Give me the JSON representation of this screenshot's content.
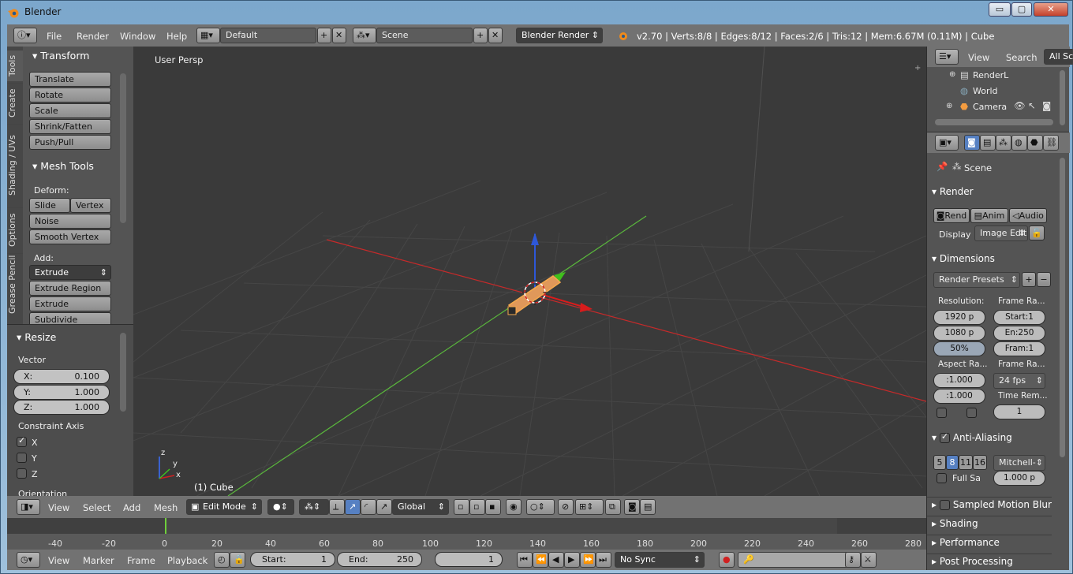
{
  "window": {
    "title": "Blender",
    "btn_min": "▭",
    "btn_max": "▢",
    "btn_close": "✕"
  },
  "info": {
    "menus": [
      "File",
      "Render",
      "Window",
      "Help"
    ],
    "layout": "Default",
    "scene": "Scene",
    "engine": "Blender Render",
    "stats": "v2.70 | Verts:8/8 | Edges:8/12 | Faces:2/6 | Tris:12 | Mem:6.67M (0.11M) | Cube"
  },
  "toolshelf": {
    "tabs": [
      "Tools",
      "Create",
      "Shading / UVs",
      "Options",
      "Grease Pencil"
    ],
    "transform": {
      "title": "Transform",
      "buttons": [
        "Translate",
        "Rotate",
        "Scale",
        "Shrink/Fatten",
        "Push/Pull"
      ]
    },
    "meshtools": {
      "title": "Mesh Tools",
      "deform_label": "Deform:",
      "slide_edge": "Slide Ed",
      "vertex": "Vertex",
      "noise": "Noise",
      "smooth_vertex": "Smooth Vertex",
      "add_label": "Add:",
      "extrude": "Extrude",
      "extrude_region": "Extrude Region",
      "extrude_individual": "Extrude Individual",
      "subdivide": "Subdivide"
    }
  },
  "operator": {
    "title": "Resize",
    "vector_label": "Vector",
    "x_label": "X:",
    "x_value": "0.100",
    "y_label": "Y:",
    "y_value": "1.000",
    "z_label": "Z:",
    "z_value": "1.000",
    "constraint_label": "Constraint Axis",
    "axes": [
      {
        "label": "X",
        "checked": true
      },
      {
        "label": "Y",
        "checked": false
      },
      {
        "label": "Z",
        "checked": false
      }
    ],
    "orientation_label": "Orientation"
  },
  "viewport": {
    "label": "User Persp",
    "object_label": "(1) Cube",
    "axis_x": "x",
    "axis_y": "y",
    "axis_z": "z"
  },
  "view3d_header": {
    "menus": [
      "View",
      "Select",
      "Add",
      "Mesh"
    ],
    "mode": "Edit Mode",
    "orientation": "Global"
  },
  "timeline": {
    "ticks": [
      "-40",
      "-20",
      "0",
      "20",
      "40",
      "60",
      "80",
      "100",
      "120",
      "140",
      "160",
      "180",
      "200",
      "220",
      "240",
      "260",
      "280"
    ],
    "menus": [
      "View",
      "Marker",
      "Frame",
      "Playback"
    ],
    "start_label": "Start:",
    "start_value": "1",
    "end_label": "End:",
    "end_value": "250",
    "current": "1",
    "sync": "No Sync"
  },
  "outliner": {
    "menus": [
      "View",
      "Search",
      "All Sc"
    ],
    "items": [
      {
        "label": "RenderL"
      },
      {
        "label": "World"
      },
      {
        "label": "Camera"
      }
    ]
  },
  "properties": {
    "scene_label": "Scene",
    "render": {
      "title": "Render",
      "render_btn": "Rend",
      "anim_btn": "Anim",
      "audio_btn": "Audio",
      "display_label": "Display",
      "display_value": "Image Edit"
    },
    "dimensions": {
      "title": "Dimensions",
      "presets": "Render Presets",
      "resolution_label": "Resolution:",
      "res_x": "1920 p",
      "res_y": "1080 p",
      "res_pct": "50%",
      "frame_range_label": "Frame Ra...",
      "start": "Start:1",
      "end": "En:250",
      "frame": "Fram:1",
      "aspect_label": "Aspect Ra...",
      "aspect_x": ":1.000",
      "aspect_y": ":1.000",
      "frame_rate_label": "Frame Ra...",
      "fps": "24 fps",
      "time_remap_label": "Time Rem...",
      "time_remap": "1"
    },
    "antialiasing": {
      "title": "Anti-Aliasing",
      "samples": [
        "5",
        "8",
        "11",
        "16"
      ],
      "filter": "Mitchell-",
      "full_sample": "Full Sa",
      "size": "1.000 p"
    },
    "sampled_motion_blur": "Sampled Motion Blur",
    "shading": "Shading",
    "performance": "Performance",
    "post_processing": "Post Processing"
  },
  "colors": {
    "accent_blue": "#5680c2",
    "x_axis": "#d0262b",
    "y_axis": "#6fbf3c",
    "selection": "#f39c40"
  }
}
